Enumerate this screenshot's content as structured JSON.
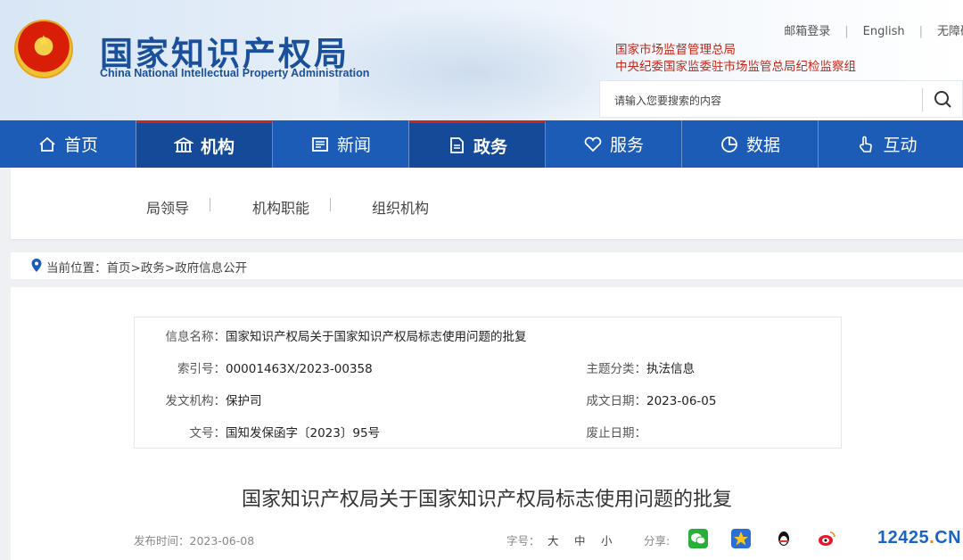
{
  "header": {
    "title_cn": "国家知识产权局",
    "title_en": "China National Intellectual Property Administration",
    "emblem_icon": "national-emblem-icon",
    "top_links": [
      "邮箱登录",
      "English",
      "无障碍"
    ],
    "sub_orgs": [
      "国家市场监督管理总局",
      "中央纪委国家监委驻市场监管总局纪检监察组"
    ],
    "search": {
      "placeholder": "请输入您要搜索的内容",
      "icon": "search-icon"
    }
  },
  "nav": {
    "items": [
      {
        "label": "首页",
        "icon": "home-icon",
        "active": false
      },
      {
        "label": "机构",
        "icon": "institution-icon",
        "active": true
      },
      {
        "label": "新闻",
        "icon": "newspaper-icon",
        "active": false
      },
      {
        "label": "政务",
        "icon": "document-icon",
        "active": true
      },
      {
        "label": "服务",
        "icon": "heart-hand-icon",
        "active": false
      },
      {
        "label": "数据",
        "icon": "pie-chart-icon",
        "active": false
      },
      {
        "label": "互动",
        "icon": "hand-pointer-icon",
        "active": false
      }
    ],
    "bg_color": "#1c5bb6",
    "active_accent": "#d0241b"
  },
  "submenu": {
    "items": [
      "局领导",
      "机构职能",
      "组织机构"
    ]
  },
  "breadcrumb": {
    "text": "当前位置：首页>政务>政府信息公开",
    "icon": "location-pin-icon"
  },
  "info": {
    "name_label": "信息名称：",
    "name_value": "国家知识产权局关于国家知识产权局标志使用问题的批复",
    "index_label": "索引号：",
    "index_value": "00001463X/2023-00358",
    "subject_label": "主题分类：",
    "subject_value": "执法信息",
    "issuer_label": "发文机构：",
    "issuer_value": "保护司",
    "date_label": "成文日期：",
    "date_value": "2023-06-05",
    "docno_label": "文号：",
    "docno_value": "国知发保函字〔2023〕95号",
    "expire_label": "废止日期：",
    "expire_value": ""
  },
  "article": {
    "title": "国家知识产权局关于国家知识产权局标志使用问题的批复",
    "publish": "发布时间：2023-06-08",
    "font_size_label": "字号：",
    "sizes": [
      "大",
      "中",
      "小"
    ],
    "share_label": "分享:",
    "share_icons": [
      "wechat-icon",
      "qzone-icon",
      "qq-icon",
      "weibo-icon"
    ]
  },
  "watermark": {
    "blue": "12425",
    "orange": ".",
    "blue2": "CN"
  }
}
